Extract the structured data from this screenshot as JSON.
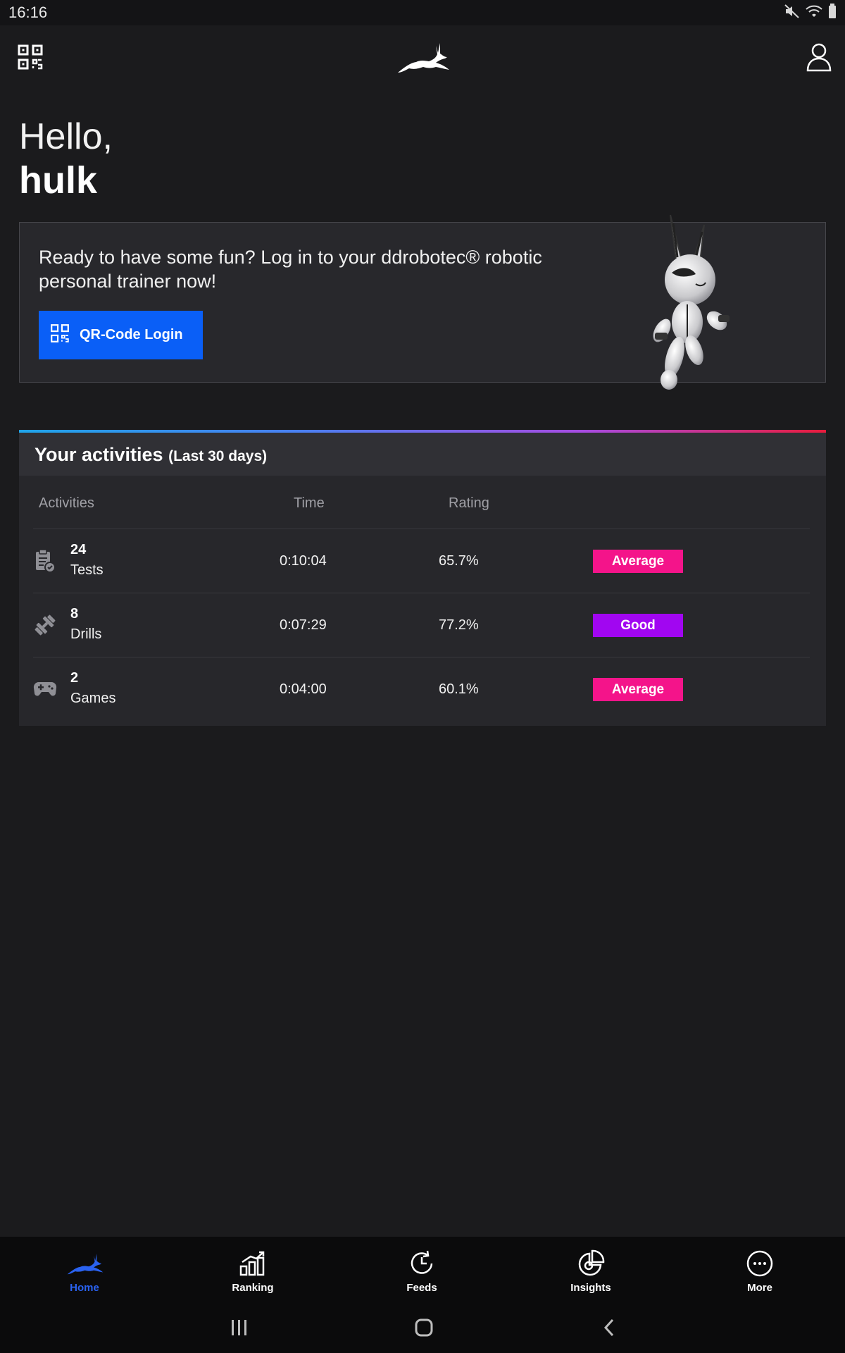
{
  "status_bar": {
    "time": "16:16",
    "icons": [
      "mute-icon",
      "wifi-icon",
      "battery-icon"
    ]
  },
  "header": {
    "left_icon": "qr-code-icon",
    "logo": "gazelle-logo",
    "right_icon": "user-profile-icon"
  },
  "greeting": {
    "hello": "Hello,",
    "name": "hulk"
  },
  "login_card": {
    "text": "Ready to have some fun? Log in to your ddrobotec® robotic personal trainer now!",
    "button_label": "QR-Code Login",
    "button_icon": "qr-code-icon",
    "button_color": "#0a5ff7"
  },
  "activities": {
    "title": "Your activities",
    "subtitle": "(Last 30 days)",
    "columns": {
      "activities": "Activities",
      "time": "Time",
      "rating": "Rating"
    },
    "rows": [
      {
        "icon": "clipboard-check-icon",
        "count": "24",
        "name": "Tests",
        "time": "0:10:04",
        "rating": "65.7%",
        "badge": "Average",
        "badge_color": "#f4148a"
      },
      {
        "icon": "dumbbell-icon",
        "count": "8",
        "name": "Drills",
        "time": "0:07:29",
        "rating": "77.2%",
        "badge": "Good",
        "badge_color": "#a106f1"
      },
      {
        "icon": "gamepad-icon",
        "count": "2",
        "name": "Games",
        "time": "0:04:00",
        "rating": "60.1%",
        "badge": "Average",
        "badge_color": "#f4148a"
      }
    ]
  },
  "bottom_nav": {
    "items": [
      {
        "label": "Home",
        "icon": "gazelle-home-icon",
        "active": true
      },
      {
        "label": "Ranking",
        "icon": "ranking-chart-icon",
        "active": false
      },
      {
        "label": "Feeds",
        "icon": "feeds-clock-icon",
        "active": false
      },
      {
        "label": "Insights",
        "icon": "insights-pie-icon",
        "active": false
      },
      {
        "label": "More",
        "icon": "more-dots-icon",
        "active": false
      }
    ]
  },
  "system_nav": {
    "icons": [
      "recent-apps-icon",
      "home-circle-icon",
      "back-icon"
    ]
  },
  "colors": {
    "accent": "#2a62f0",
    "background": "#1b1b1d",
    "card": "#28282c"
  }
}
